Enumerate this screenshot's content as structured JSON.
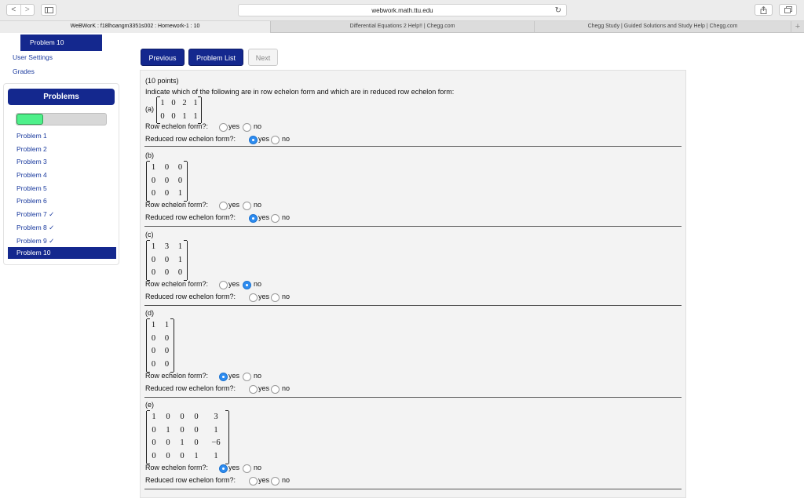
{
  "browser": {
    "url": "webwork.math.ttu.edu",
    "tabs": [
      {
        "title": "WeBWorK : f18lhoangm3351s002 : Homework-1 : 10"
      },
      {
        "title": "Differential Equations 2 Help!! | Chegg.com"
      },
      {
        "title": "Chegg Study | Guided Solutions and Study Help | Chegg.com"
      }
    ],
    "new_tab_symbol": "+",
    "back_symbol": "<",
    "forward_symbol": ">",
    "reload_symbol": "↻"
  },
  "sidebar": {
    "current_problem": "Problem 10",
    "links": [
      "User Settings",
      "Grades"
    ],
    "problems_title": "Problems",
    "progress_fraction": 0.3,
    "problems": [
      "Problem 1",
      "Problem 2",
      "Problem 3",
      "Problem 4",
      "Problem 5",
      "Problem 6",
      "Problem 7 ✓",
      "Problem 8 ✓",
      "Problem 9 ✓",
      "Problem 10"
    ]
  },
  "nav_buttons": {
    "previous": "Previous",
    "problem_list": "Problem List",
    "next": "Next"
  },
  "problem": {
    "points": "(10 points)",
    "prompt": "Indicate which of the following are in row echelon form and which are in reduced row echelon form:",
    "ref_question": "Row echelon form?:",
    "rref_question": "Reduced row echelon form?:",
    "yes_label": "yes",
    "no_label": "no",
    "parts": [
      {
        "label": "(a)",
        "matrix": [
          [
            "1",
            "0",
            "2",
            "1"
          ],
          [
            "0",
            "0",
            "1",
            "1"
          ]
        ],
        "ref": "",
        "rref": "yes"
      },
      {
        "label": "(b)",
        "matrix": [
          [
            "1",
            "0",
            "0"
          ],
          [
            "0",
            "0",
            "0"
          ],
          [
            "0",
            "0",
            "1"
          ]
        ],
        "ref": "",
        "rref": "yes"
      },
      {
        "label": "(c)",
        "matrix": [
          [
            "1",
            "3",
            "1"
          ],
          [
            "0",
            "0",
            "1"
          ],
          [
            "0",
            "0",
            "0"
          ]
        ],
        "ref": "no",
        "rref": ""
      },
      {
        "label": "(d)",
        "matrix": [
          [
            "1",
            "1"
          ],
          [
            "0",
            "0"
          ],
          [
            "0",
            "0"
          ],
          [
            "0",
            "0"
          ]
        ],
        "ref": "yes",
        "rref": ""
      },
      {
        "label": "(e)",
        "matrix": [
          [
            "1",
            "0",
            "0",
            "0",
            "3"
          ],
          [
            "0",
            "1",
            "0",
            "0",
            "1"
          ],
          [
            "0",
            "0",
            "1",
            "0",
            "−6"
          ],
          [
            "0",
            "0",
            "0",
            "1",
            "1"
          ]
        ],
        "ref": "yes",
        "rref": ""
      }
    ]
  }
}
